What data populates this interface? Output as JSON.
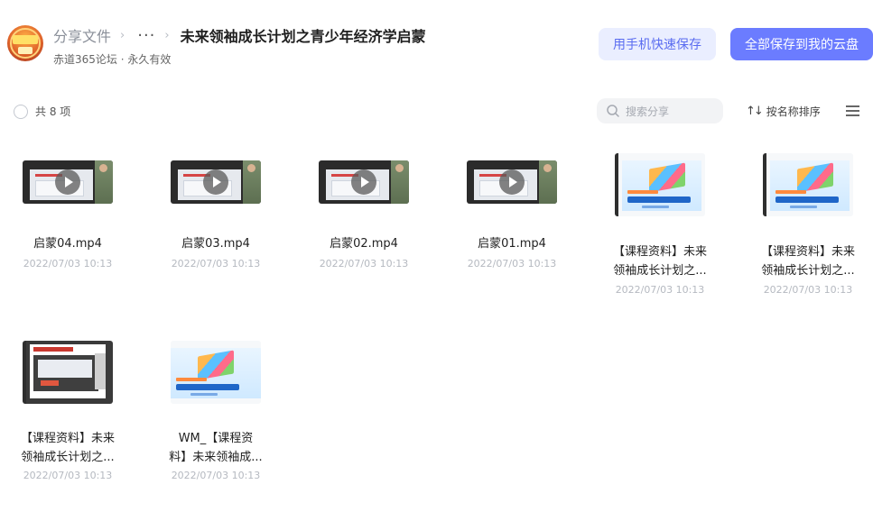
{
  "header": {
    "breadcrumb_root": "分享文件",
    "breadcrumb_more": "···",
    "breadcrumb_sep": "›",
    "title": "未来领袖成长计划之青少年经济学启蒙",
    "subtitle": "赤道365论坛 · 永久有效",
    "btn_phone_save": "用手机快速保存",
    "btn_save_all": "全部保存到我的云盘"
  },
  "toolbar": {
    "count_text": "共 8 项",
    "search_placeholder": "搜索分享",
    "sort_label": "按名称排序",
    "sort_icon_glyph": "↑↓"
  },
  "files": [
    {
      "name_line1": "启蒙04.mp4",
      "name_line2": "",
      "date": "2022/07/03 10:13",
      "type": "video"
    },
    {
      "name_line1": "启蒙03.mp4",
      "name_line2": "",
      "date": "2022/07/03 10:13",
      "type": "video"
    },
    {
      "name_line1": "启蒙02.mp4",
      "name_line2": "",
      "date": "2022/07/03 10:13",
      "type": "video"
    },
    {
      "name_line1": "启蒙01.mp4",
      "name_line2": "",
      "date": "2022/07/03 10:13",
      "type": "video"
    },
    {
      "name_line1": "【课程资料】未来",
      "name_line2": "领袖成长计划之...",
      "date": "2022/07/03 10:13",
      "type": "document"
    },
    {
      "name_line1": "【课程资料】未来",
      "name_line2": "领袖成长计划之...",
      "date": "2022/07/03 10:13",
      "type": "document"
    },
    {
      "name_line1": "【课程资料】未来",
      "name_line2": "领袖成长计划之...",
      "date": "2022/07/03 10:13",
      "type": "presentation"
    },
    {
      "name_line1": "WM_【课程资",
      "name_line2": "料】未来领袖成...",
      "date": "2022/07/03 10:13",
      "type": "document"
    }
  ],
  "colors": {
    "accent": "#6b7cff",
    "accent_light_bg": "#eaeeff",
    "muted_text": "#b5b9c0"
  }
}
